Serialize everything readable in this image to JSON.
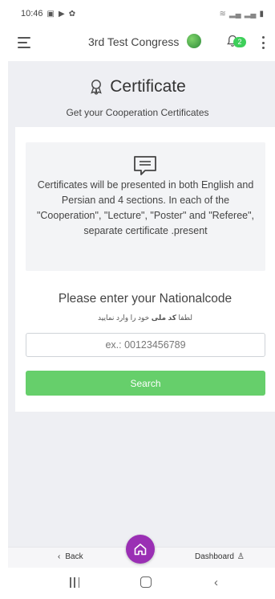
{
  "status_bar": {
    "time": "10:46",
    "left_icons": [
      "gallery-icon",
      "play-store-icon",
      "notification-icon"
    ],
    "right_icons": [
      "wifi-icon",
      "signal-icon",
      "signal-icon",
      "battery-icon"
    ]
  },
  "header": {
    "title": "3rd Test Congress",
    "notification_count": "2"
  },
  "page": {
    "title": "Certificate",
    "subtitle": "Get your Cooperation Certificates",
    "info_text": "Certificates will be presented in both English and Persian and 4 sections. In each of the \"Cooperation\", \"Lecture\", \"Poster\" and \"Referee\", separate certificate .present",
    "national_prompt": "Please enter your Nationalcode",
    "persian_hint_pre": "لطفا ",
    "persian_hint_bold": "کد ملی",
    "persian_hint_post": " خود را وارد نمایید",
    "input_placeholder": "ex.: 00123456789",
    "input_value": "",
    "search_label": "Search"
  },
  "bottom_nav": {
    "back_label": "Back",
    "dashboard_label": "Dashboard"
  },
  "colors": {
    "accent_green": "#66cf6b",
    "badge_green": "#3ecf5a",
    "home_purple": "#9a2fb4",
    "background_gray": "#eeeff3"
  }
}
